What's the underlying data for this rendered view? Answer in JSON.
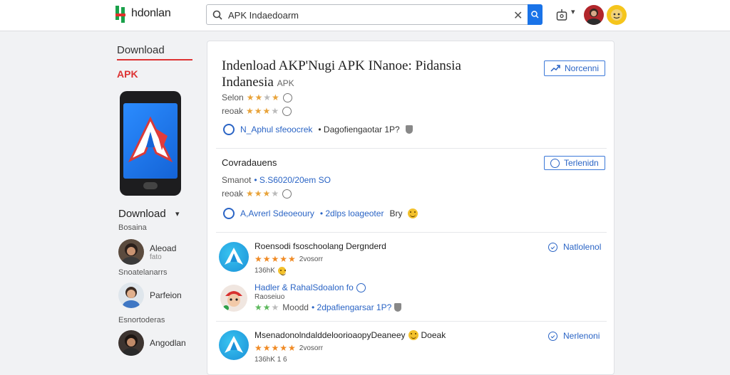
{
  "header": {
    "logo_text": "hdonlan",
    "search_value": "APK Indaedoarm",
    "search_placeholder": "APK Indaedoarm"
  },
  "sidebar": {
    "heading": "Download",
    "tag": "APK",
    "download_label": "Download",
    "section1": "Bosaina",
    "people": [
      {
        "name": "Aleoad",
        "sub": "fato"
      },
      {
        "name": "Parfeion",
        "sub": ""
      },
      {
        "name": "Angodlan",
        "sub": ""
      }
    ],
    "section2": "Snoatelanarrs",
    "section3": "Esnortoderas"
  },
  "main": {
    "title_line1": "Indenload AKP'Nugi APK INanoe: Pidansia",
    "title_line2": "Indanesia",
    "title_apk": "APK",
    "top_button": "Norcenni",
    "rating1_label": "Selon",
    "rating2_label": "reoak",
    "link1_text": "N_Aphul sfeoocrek",
    "link1_meta": "• Dagofiengaotar 1P?",
    "section_title": "Covradauens",
    "section_button": "Terlenidn",
    "stat_label": "Smanot",
    "stat_value": "• S.S6020/20em SO",
    "rating3_label": "reoak",
    "link2_text": "A,Avrerl Sdeoeoury",
    "link2_meta": "• 2dlps loageoter",
    "link2_extra": "Bry",
    "apps": [
      {
        "title": "Roensodi fsoschoolang Dergnderd",
        "meta": "2vosorr",
        "count": "136hK",
        "button": "Natlolenol"
      },
      {
        "title": "Hadler & RahalSdoalon fo",
        "meta": "• 2dpafiengarsar 1P?",
        "count": "Moodd",
        "sub": "Raoseiuo"
      },
      {
        "title": "MsenadonolndalddeloorioaopyDeaneey",
        "extra": "Doeak",
        "meta": "2vosorr",
        "count": "136hK 1 6",
        "button": "Nerlenoni"
      }
    ]
  },
  "colors": {
    "accent": "#1a73e8",
    "brand_red": "#d33333",
    "star": "#e8a33a",
    "logo_green": "#1aa14a"
  }
}
